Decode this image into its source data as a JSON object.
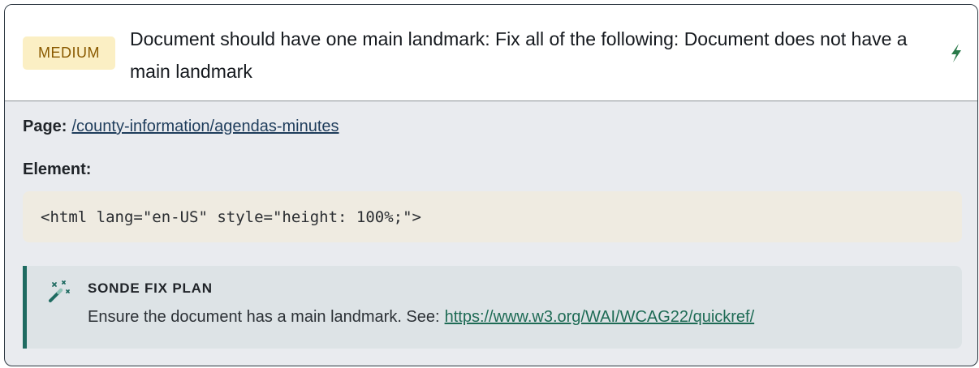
{
  "issue": {
    "severity": "MEDIUM",
    "title": "Document should have one main landmark: Fix all of the following: Document does not have a main landmark",
    "page_label": "Page:",
    "page_path": "/county-information/agendas-minutes",
    "element_label": "Element:",
    "element_code": "<html lang=\"en-US\" style=\"height: 100%;\">"
  },
  "fix_plan": {
    "heading": "SONDE FIX PLAN",
    "text": "Ensure the document has a main landmark. See:",
    "link": "https://www.w3.org/WAI/WCAG22/quickref/"
  },
  "icons": {
    "header_action": "zap-icon",
    "fix_plan": "magic-wand-icon"
  },
  "colors": {
    "severity_bg": "#fbefc4",
    "severity_text": "#8a5a00",
    "code_bg": "#efebe1",
    "fix_accent": "#1f6b61",
    "link": "#1e6b55"
  }
}
